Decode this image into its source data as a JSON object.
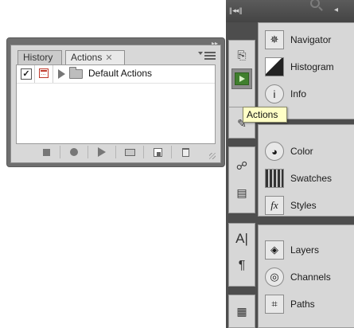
{
  "actions_panel": {
    "tabs": [
      {
        "label": "History"
      },
      {
        "label": "Actions",
        "close": "✕"
      }
    ],
    "rows": [
      {
        "checked": "✓",
        "set_name": "Default Actions"
      }
    ],
    "bottom_buttons": [
      "stop-icon",
      "record-icon",
      "play-icon",
      "new-set-icon",
      "new-action-icon",
      "delete-icon"
    ]
  },
  "dock": {
    "top_arrows": "|| ◂◂ ||",
    "collapse_arrow": "◂",
    "groups": [
      {
        "items": [
          {
            "label": "Navigator",
            "icon": "navigator-icon"
          },
          {
            "label": "Histogram",
            "icon": "histogram-icon"
          },
          {
            "label": "Info",
            "icon": "info-icon"
          }
        ]
      },
      {
        "items": [
          {
            "label": "Color",
            "icon": "color-icon"
          },
          {
            "label": "Swatches",
            "icon": "swatches-icon"
          },
          {
            "label": "Styles",
            "icon": "styles-icon"
          }
        ]
      },
      {
        "items": [
          {
            "label": "Layers",
            "icon": "layers-icon"
          },
          {
            "label": "Channels",
            "icon": "channels-icon"
          },
          {
            "label": "Paths",
            "icon": "paths-icon"
          }
        ]
      }
    ]
  },
  "tooltip": {
    "text": "Actions"
  },
  "colors": {
    "active_button": "#3f7f2d",
    "tooltip_bg": "#ffffc6",
    "dock_bg": "#4d4d4d"
  }
}
